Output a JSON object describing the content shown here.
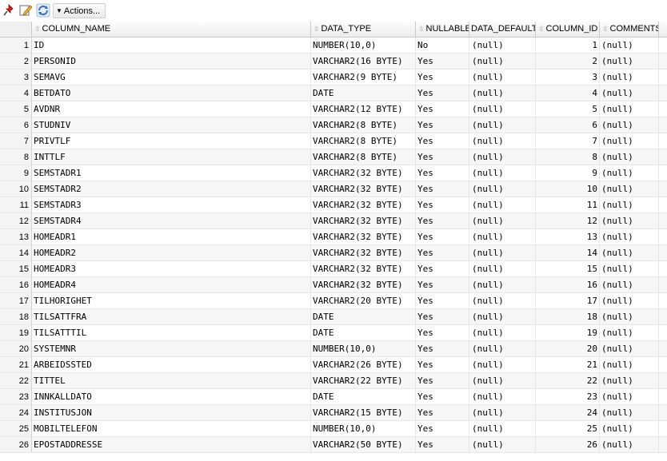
{
  "toolbar": {
    "icons": [
      "pin-icon",
      "edit-icon",
      "refresh-icon"
    ],
    "actions_label": "Actions..."
  },
  "columns": {
    "column_name": "COLUMN_NAME",
    "data_type": "DATA_TYPE",
    "nullable": "NULLABLE",
    "data_default": "DATA_DEFAULT",
    "column_id": "COLUMN_ID",
    "comments": "COMMENTS"
  },
  "rows": [
    {
      "n": "1",
      "name": "ID",
      "type": "NUMBER(10,0)",
      "nullable": "No",
      "def": "(null)",
      "id": "1",
      "com": "(null)"
    },
    {
      "n": "2",
      "name": "PERSONID",
      "type": "VARCHAR2(16 BYTE)",
      "nullable": "Yes",
      "def": "(null)",
      "id": "2",
      "com": "(null)"
    },
    {
      "n": "3",
      "name": "SEMAVG",
      "type": "VARCHAR2(9 BYTE)",
      "nullable": "Yes",
      "def": "(null)",
      "id": "3",
      "com": "(null)"
    },
    {
      "n": "4",
      "name": "BETDATO",
      "type": "DATE",
      "nullable": "Yes",
      "def": "(null)",
      "id": "4",
      "com": "(null)"
    },
    {
      "n": "5",
      "name": "AVDNR",
      "type": "VARCHAR2(12 BYTE)",
      "nullable": "Yes",
      "def": "(null)",
      "id": "5",
      "com": "(null)"
    },
    {
      "n": "6",
      "name": "STUDNIV",
      "type": "VARCHAR2(8 BYTE)",
      "nullable": "Yes",
      "def": "(null)",
      "id": "6",
      "com": "(null)"
    },
    {
      "n": "7",
      "name": "PRIVTLF",
      "type": "VARCHAR2(8 BYTE)",
      "nullable": "Yes",
      "def": "(null)",
      "id": "7",
      "com": "(null)"
    },
    {
      "n": "8",
      "name": "INTTLF",
      "type": "VARCHAR2(8 BYTE)",
      "nullable": "Yes",
      "def": "(null)",
      "id": "8",
      "com": "(null)"
    },
    {
      "n": "9",
      "name": "SEMSTADR1",
      "type": "VARCHAR2(32 BYTE)",
      "nullable": "Yes",
      "def": "(null)",
      "id": "9",
      "com": "(null)"
    },
    {
      "n": "10",
      "name": "SEMSTADR2",
      "type": "VARCHAR2(32 BYTE)",
      "nullable": "Yes",
      "def": "(null)",
      "id": "10",
      "com": "(null)"
    },
    {
      "n": "11",
      "name": "SEMSTADR3",
      "type": "VARCHAR2(32 BYTE)",
      "nullable": "Yes",
      "def": "(null)",
      "id": "11",
      "com": "(null)"
    },
    {
      "n": "12",
      "name": "SEMSTADR4",
      "type": "VARCHAR2(32 BYTE)",
      "nullable": "Yes",
      "def": "(null)",
      "id": "12",
      "com": "(null)"
    },
    {
      "n": "13",
      "name": "HOMEADR1",
      "type": "VARCHAR2(32 BYTE)",
      "nullable": "Yes",
      "def": "(null)",
      "id": "13",
      "com": "(null)"
    },
    {
      "n": "14",
      "name": "HOMEADR2",
      "type": "VARCHAR2(32 BYTE)",
      "nullable": "Yes",
      "def": "(null)",
      "id": "14",
      "com": "(null)"
    },
    {
      "n": "15",
      "name": "HOMEADR3",
      "type": "VARCHAR2(32 BYTE)",
      "nullable": "Yes",
      "def": "(null)",
      "id": "15",
      "com": "(null)"
    },
    {
      "n": "16",
      "name": "HOMEADR4",
      "type": "VARCHAR2(32 BYTE)",
      "nullable": "Yes",
      "def": "(null)",
      "id": "16",
      "com": "(null)"
    },
    {
      "n": "17",
      "name": "TILHORIGHET",
      "type": "VARCHAR2(20 BYTE)",
      "nullable": "Yes",
      "def": "(null)",
      "id": "17",
      "com": "(null)"
    },
    {
      "n": "18",
      "name": "TILSATTFRA",
      "type": "DATE",
      "nullable": "Yes",
      "def": "(null)",
      "id": "18",
      "com": "(null)"
    },
    {
      "n": "19",
      "name": "TILSATTTIL",
      "type": "DATE",
      "nullable": "Yes",
      "def": "(null)",
      "id": "19",
      "com": "(null)"
    },
    {
      "n": "20",
      "name": "SYSTEMNR",
      "type": "NUMBER(10,0)",
      "nullable": "Yes",
      "def": "(null)",
      "id": "20",
      "com": "(null)"
    },
    {
      "n": "21",
      "name": "ARBEIDSSTED",
      "type": "VARCHAR2(26 BYTE)",
      "nullable": "Yes",
      "def": "(null)",
      "id": "21",
      "com": "(null)"
    },
    {
      "n": "22",
      "name": "TITTEL",
      "type": "VARCHAR2(22 BYTE)",
      "nullable": "Yes",
      "def": "(null)",
      "id": "22",
      "com": "(null)"
    },
    {
      "n": "23",
      "name": "INNKALLDATO",
      "type": "DATE",
      "nullable": "Yes",
      "def": "(null)",
      "id": "23",
      "com": "(null)"
    },
    {
      "n": "24",
      "name": "INSTITUSJON",
      "type": "VARCHAR2(15 BYTE)",
      "nullable": "Yes",
      "def": "(null)",
      "id": "24",
      "com": "(null)"
    },
    {
      "n": "25",
      "name": "MOBILTELEFON",
      "type": "NUMBER(10,0)",
      "nullable": "Yes",
      "def": "(null)",
      "id": "25",
      "com": "(null)"
    },
    {
      "n": "26",
      "name": "EPOSTADDRESSE",
      "type": "VARCHAR2(50 BYTE)",
      "nullable": "Yes",
      "def": "(null)",
      "id": "26",
      "com": "(null)"
    }
  ]
}
